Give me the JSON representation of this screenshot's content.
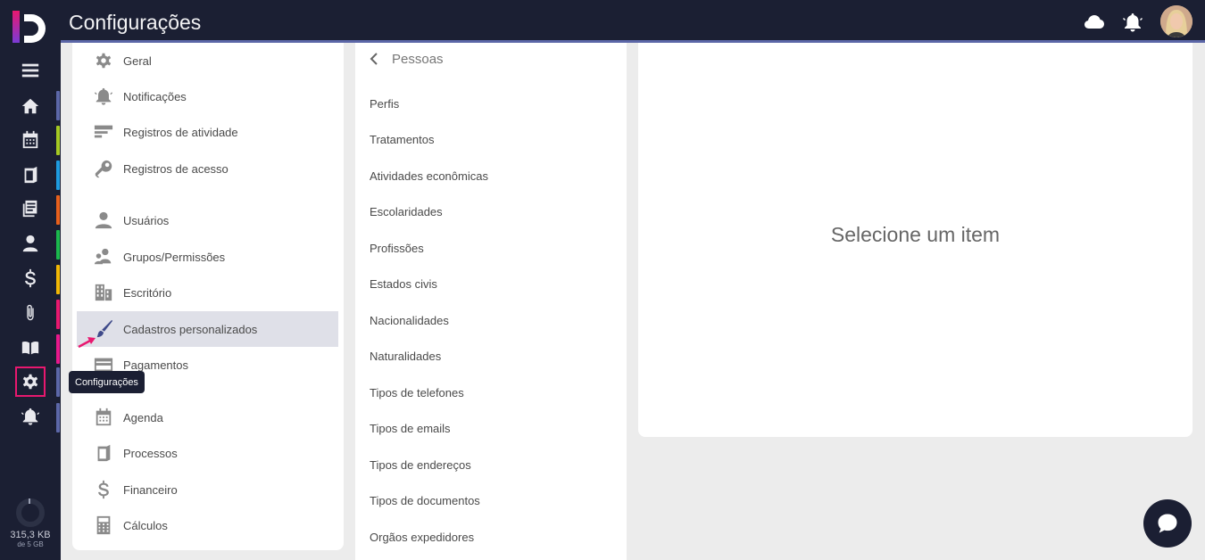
{
  "header": {
    "title": "Configurações"
  },
  "tooltip": {
    "text": "Configurações"
  },
  "storage": {
    "used": "315,3 KB",
    "total": "de 5 GB"
  },
  "rail": {
    "items": [
      {
        "name": "menu-icon"
      },
      {
        "name": "home-icon",
        "bar_color": "#5c67a8"
      },
      {
        "name": "calendar-icon",
        "bar_color": "#a5c923"
      },
      {
        "name": "process-icon",
        "bar_color": "#1e9be0"
      },
      {
        "name": "document-icon",
        "bar_color": "#e8601c"
      },
      {
        "name": "person-icon",
        "bar_color": "#1bb84d"
      },
      {
        "name": "dollar-icon",
        "bar_color": "#f2b705"
      },
      {
        "name": "attachment-icon",
        "bar_color": "#e8186f"
      },
      {
        "name": "book-icon",
        "bar_color": "#e8188c"
      },
      {
        "name": "gear-icon",
        "bar_color": "#5c67a8"
      },
      {
        "name": "bell-icon",
        "bar_color": "#5c67a8"
      }
    ]
  },
  "settings": {
    "items": [
      {
        "label": "Geral",
        "icon": "gear-icon"
      },
      {
        "label": "Notificações",
        "icon": "bell-icon"
      },
      {
        "label": "Registros de atividade",
        "icon": "activity-log-icon"
      },
      {
        "label": "Registros de acesso",
        "icon": "key-icon"
      },
      {
        "label": "Usuários",
        "icon": "user-icon"
      },
      {
        "label": "Grupos/Permissões",
        "icon": "group-icon"
      },
      {
        "label": "Escritório",
        "icon": "building-icon"
      },
      {
        "label": "Cadastros personalizados",
        "icon": "brush-icon",
        "selected": true
      },
      {
        "label": "Pagamentos",
        "icon": "card-icon"
      },
      {
        "label": "Agenda",
        "icon": "calendar-icon"
      },
      {
        "label": "Processos",
        "icon": "process-icon"
      },
      {
        "label": "Financeiro",
        "icon": "dollar-icon"
      },
      {
        "label": "Cálculos",
        "icon": "calculator-icon"
      }
    ]
  },
  "sublist": {
    "back_label": "Pessoas",
    "items": [
      "Perfis",
      "Tratamentos",
      "Atividades econômicas",
      "Escolaridades",
      "Profissões",
      "Estados civis",
      "Nacionalidades",
      "Naturalidades",
      "Tipos de telefones",
      "Tipos de emails",
      "Tipos de endereços",
      "Tipos de documentos",
      "Orgãos expedidores"
    ]
  },
  "detail": {
    "empty_message": "Selecione um item"
  },
  "colors": {
    "dark": "#1b1f33",
    "accent": "#5c67a8",
    "highlight": "#e8186f",
    "selected_row": "#dfe0e8"
  }
}
